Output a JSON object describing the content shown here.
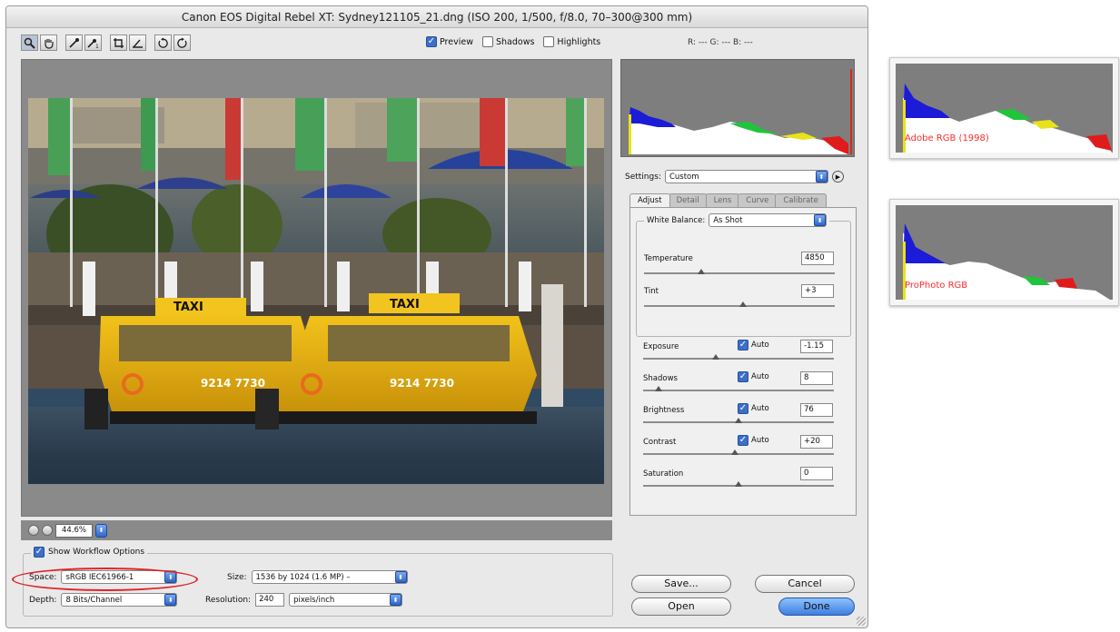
{
  "window": {
    "title": "Canon EOS Digital Rebel XT:  Sydney121105_21.dng  (ISO 200, 1/500, f/8.0, 70–300@300 mm)"
  },
  "toolbar": {
    "tools": [
      "zoom-tool-icon",
      "hand-tool-icon",
      "white-balance-tool-icon",
      "color-sampler-tool-icon",
      "crop-tool-icon",
      "straighten-tool-icon",
      "rotate-left-icon",
      "rotate-right-icon"
    ],
    "preview_label": "Preview",
    "preview_checked": true,
    "shadows_label": "Shadows",
    "shadows_checked": false,
    "highlights_label": "Highlights",
    "highlights_checked": false,
    "rgb_readout": "R: ---  G: ---  B: ---"
  },
  "photo": {
    "description_icons": "harbor-taxi-photo",
    "taxi_sign_1": "TAXI",
    "taxi_sign_2": "TAXI",
    "boat_number_1": "9214 7730",
    "boat_number_2": "9214 7730"
  },
  "zoom": {
    "value": "44.6%"
  },
  "workflow": {
    "show_label": "Show Workflow Options",
    "show_checked": true,
    "space_label": "Space:",
    "space_value": "sRGB IEC61966-1",
    "size_label": "Size:",
    "size_value": "1536 by 1024 (1.6 MP)  –",
    "depth_label": "Depth:",
    "depth_value": "8 Bits/Channel",
    "resolution_label": "Resolution:",
    "resolution_value": "240",
    "resolution_unit": "pixels/inch"
  },
  "settings": {
    "label": "Settings:",
    "value": "Custom"
  },
  "tabs": [
    "Adjust",
    "Detail",
    "Lens",
    "Curve",
    "Calibrate"
  ],
  "adjust": {
    "white_balance_label": "White Balance:",
    "white_balance_value": "As Shot",
    "temperature_label": "Temperature",
    "temperature_value": "4850",
    "temperature_pos": 0.3,
    "tint_label": "Tint",
    "tint_value": "+3",
    "tint_pos": 0.52,
    "auto_label": "Auto",
    "sliders": [
      {
        "label": "Exposure",
        "value": "-1.15",
        "auto": true,
        "pos": 0.38
      },
      {
        "label": "Shadows",
        "value": "8",
        "auto": true,
        "pos": 0.08
      },
      {
        "label": "Brightness",
        "value": "76",
        "auto": true,
        "pos": 0.5
      },
      {
        "label": "Contrast",
        "value": "+20",
        "auto": true,
        "pos": 0.48
      },
      {
        "label": "Saturation",
        "value": "0",
        "auto": false,
        "pos": 0.5
      }
    ]
  },
  "buttons": {
    "save": "Save...",
    "cancel": "Cancel",
    "open": "Open",
    "done": "Done"
  },
  "side_histograms": {
    "adobe_label": "Adobe RGB (1998)",
    "prophoto_label": "ProPhoto RGB"
  },
  "colors": {
    "accent": "#3e7fe0",
    "highlight_ring": "#e0252a",
    "panel_bg": "#e9e9e9"
  }
}
